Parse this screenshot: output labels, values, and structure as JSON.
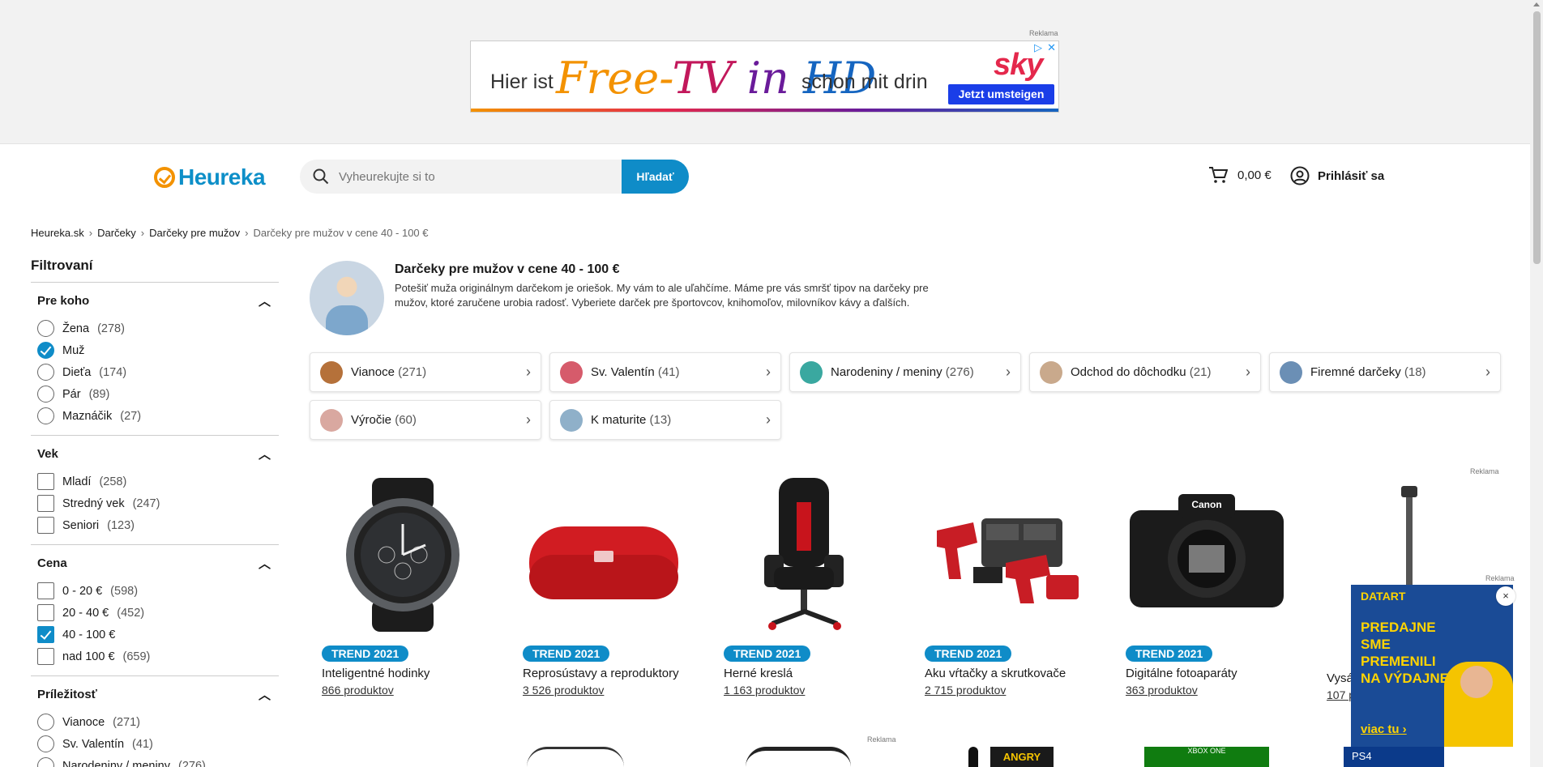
{
  "ad_top": {
    "label": "Reklama",
    "text_before": "Hier ist",
    "free": "Free-",
    "tv": "TV",
    "in": "in",
    "hd": "HD",
    "text_after": "schon mit drin",
    "brand": "sky",
    "cta": "Jetzt umsteigen"
  },
  "header": {
    "logo_text": "Heureka",
    "search_placeholder": "Vyheurekujte si to",
    "search_button": "Hľadať",
    "cart_total": "0,00 €",
    "login_label": "Prihlásiť sa"
  },
  "breadcrumb": [
    {
      "label": "Heureka.sk"
    },
    {
      "label": "Darčeky"
    },
    {
      "label": "Darčeky pre mužov"
    },
    {
      "label": "Darčeky pre mužov v cene 40 - 100 €"
    }
  ],
  "sidebar": {
    "title": "Filtrovaní",
    "sections": [
      {
        "title": "Pre koho",
        "options": [
          {
            "label": "Žena",
            "count": "(278)",
            "checked": false
          },
          {
            "label": "Muž",
            "count": "",
            "checked": true
          },
          {
            "label": "Dieťa",
            "count": "(174)",
            "checked": false
          },
          {
            "label": "Pár",
            "count": "(89)",
            "checked": false
          },
          {
            "label": "Maznáčik",
            "count": "(27)",
            "checked": false
          }
        ]
      },
      {
        "title": "Vek",
        "options": [
          {
            "label": "Mladí",
            "count": "(258)",
            "checked": false
          },
          {
            "label": "Stredný vek",
            "count": "(247)",
            "checked": false
          },
          {
            "label": "Seniori",
            "count": "(123)",
            "checked": false
          }
        ]
      },
      {
        "title": "Cena",
        "options": [
          {
            "label": "0 - 20 €",
            "count": "(598)",
            "checked": false
          },
          {
            "label": "20 - 40 €",
            "count": "(452)",
            "checked": false
          },
          {
            "label": "40 - 100 €",
            "count": "",
            "checked": true
          },
          {
            "label": "nad 100 €",
            "count": "(659)",
            "checked": false
          }
        ]
      },
      {
        "title": "Príležitosť",
        "options": [
          {
            "label": "Vianoce",
            "count": "(271)",
            "checked": false
          },
          {
            "label": "Sv. Valentín",
            "count": "(41)",
            "checked": false
          },
          {
            "label": "Narodeniny / meniny",
            "count": "(276)",
            "checked": false
          }
        ]
      }
    ]
  },
  "hero": {
    "title": "Darčeky pre mužov v cene 40 - 100 €",
    "description": "Potešiť muža originálnym darčekom je oriešok. My vám to ale uľahčíme. Máme pre vás smršť tipov na darčeky pre mužov, ktoré zaručene urobia radosť. Vyberiete darček pre športovcov, knihomoľov, milovníkov kávy a ďalších."
  },
  "occasions": [
    {
      "label": "Vianoce",
      "count": "(271)",
      "color": "#b5713a"
    },
    {
      "label": "Sv. Valentín",
      "count": "(41)",
      "color": "#d65b6b"
    },
    {
      "label": "Narodeniny / meniny",
      "count": "(276)",
      "color": "#3aa8a0"
    },
    {
      "label": "Odchod do dôchodku",
      "count": "(21)",
      "color": "#c9a98c"
    },
    {
      "label": "Firemné darčeky",
      "count": "(18)",
      "color": "#6b8fb5"
    },
    {
      "label": "Výročie",
      "count": "(60)",
      "color": "#d9a8a0"
    },
    {
      "label": "K maturite",
      "count": "(13)",
      "color": "#8fb0c9"
    }
  ],
  "products_ad_label": "Reklama",
  "products": [
    {
      "badge": "TREND 2021",
      "name": "Inteligentné hodinky",
      "count": "866 produktov",
      "icon": "smartwatch"
    },
    {
      "badge": "TREND 2021",
      "name": "Reprosústavy a reproduktory",
      "count": "3 526 produktov",
      "icon": "speaker"
    },
    {
      "badge": "TREND 2021",
      "name": "Herné kreslá",
      "count": "1 163 produktov",
      "icon": "gaming-chair"
    },
    {
      "badge": "TREND 2021",
      "name": "Aku vŕtačky a skrutkovače",
      "count": "2 715 produktov",
      "icon": "drill-set"
    },
    {
      "badge": "TREND 2021",
      "name": "Digitálne fotoaparáty",
      "count": "363 produktov",
      "icon": "camera"
    },
    {
      "badge": "",
      "name": "Vysá",
      "count": "107 p",
      "icon": "vacuum"
    }
  ],
  "float_ad": {
    "label": "Reklama",
    "brand": "DATART",
    "headline": "PREDAJNE SME PREMENILI NA VÝDAJNE",
    "more": "viac tu ›",
    "close": "×"
  },
  "row2_ad_label": "Reklama",
  "row2": {
    "angry": "ANGRY",
    "xbox": "XBOX ONE",
    "ps4": "PS4"
  }
}
